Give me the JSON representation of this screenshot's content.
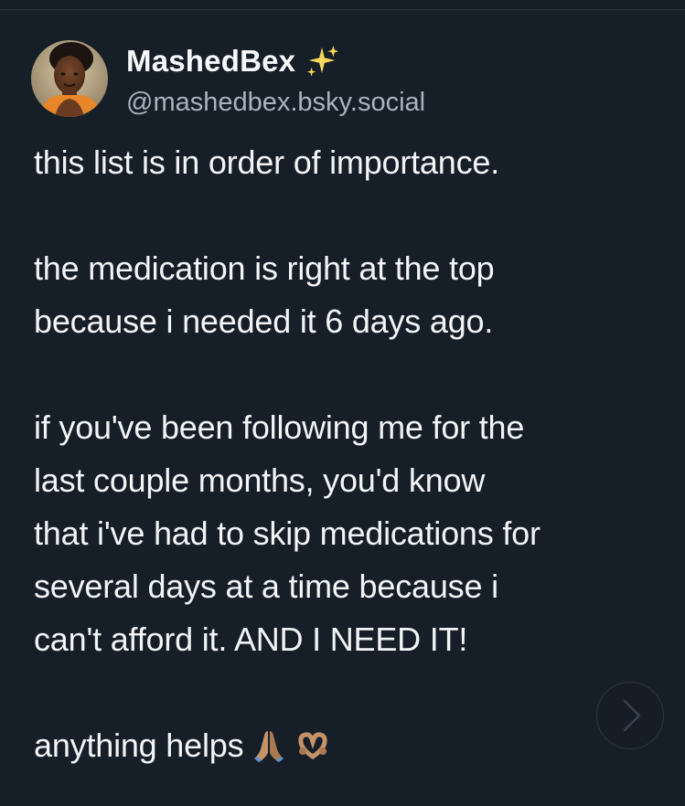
{
  "post": {
    "author_name": "MashedBex",
    "author_emoji_icon": "sparkles-icon",
    "handle": "@mashedbex.bsky.social",
    "paragraphs": [
      "this list is in order of importance.",
      "the medication is right at the top\nbecause i needed it 6 days ago.",
      "if you've been following me for the\nlast couple months, you'd know\nthat i've had to skip medications for\nseveral days at a time because i\ncan't afford it. AND I NEED IT!"
    ],
    "closing_text": "anything helps",
    "closing_emoji_icons": [
      "folded-hands-icon",
      "heart-hands-icon"
    ]
  },
  "controls": {
    "next_icon": "chevron-right-icon"
  },
  "colors": {
    "background": "#161e27",
    "text": "#f2f4f6",
    "handle": "#aab4c0",
    "sparkle": "#f7d85a"
  }
}
